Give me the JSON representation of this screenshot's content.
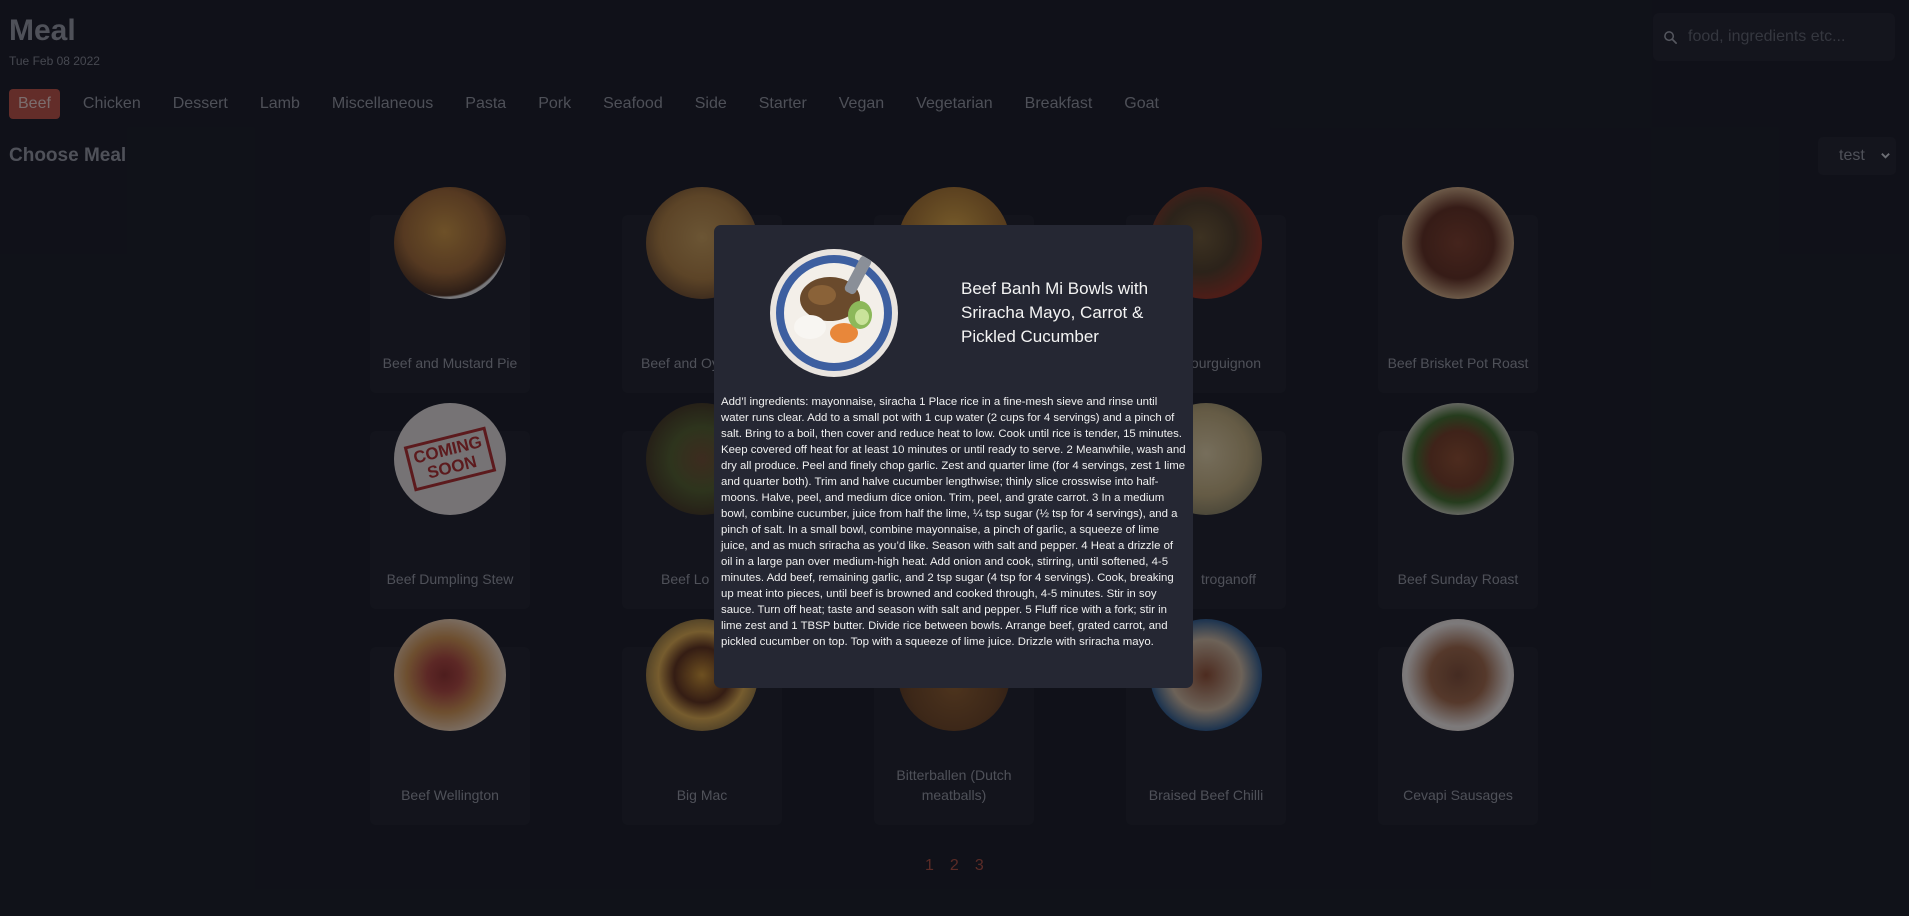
{
  "header": {
    "title": "Meal",
    "date": "Tue Feb 08 2022"
  },
  "search": {
    "placeholder": "food, ingredients etc..."
  },
  "categories": [
    {
      "label": "Beef",
      "active": true
    },
    {
      "label": "Chicken"
    },
    {
      "label": "Dessert"
    },
    {
      "label": "Lamb"
    },
    {
      "label": "Miscellaneous"
    },
    {
      "label": "Pasta"
    },
    {
      "label": "Pork"
    },
    {
      "label": "Seafood"
    },
    {
      "label": "Side"
    },
    {
      "label": "Starter"
    },
    {
      "label": "Vegan"
    },
    {
      "label": "Vegetarian"
    },
    {
      "label": "Breakfast"
    },
    {
      "label": "Goat"
    }
  ],
  "section": {
    "title": "Choose Meal"
  },
  "select": {
    "value": "test"
  },
  "meals": [
    {
      "name": "Beef and Mustard Pie"
    },
    {
      "name": "Beef and Oy"
    },
    {
      "name": ""
    },
    {
      "name": "bourguignon"
    },
    {
      "name": "Beef Brisket Pot Roast"
    },
    {
      "name": "Beef Dumpling Stew"
    },
    {
      "name": "Beef Lo M"
    },
    {
      "name": ""
    },
    {
      "name": "troganoff"
    },
    {
      "name": "Beef Sunday Roast"
    },
    {
      "name": "Beef Wellington"
    },
    {
      "name": "Big Mac"
    },
    {
      "name": "Bitterballen (Dutch meatballs)"
    },
    {
      "name": "Braised Beef Chilli"
    },
    {
      "name": "Cevapi Sausages"
    }
  ],
  "pagination": [
    "1",
    "2",
    "3"
  ],
  "modal": {
    "title": "Beef Banh Mi Bowls with Sriracha Mayo, Carrot & Pickled Cucumber",
    "instructions": "Add’l ingredients: mayonnaise, siracha 1 Place rice in a fine-mesh sieve and rinse until water runs clear. Add to a small pot with 1 cup water (2 cups for 4 servings) and a pinch of salt. Bring to a boil, then cover and reduce heat to low. Cook until rice is tender, 15 minutes. Keep covered off heat for at least 10 minutes or until ready to serve. 2 Meanwhile, wash and dry all produce. Peel and finely chop garlic. Zest and quarter lime (for 4 servings, zest 1 lime and quarter both). Trim and halve cucumber lengthwise; thinly slice crosswise into half-moons. Halve, peel, and medium dice onion. Trim, peel, and grate carrot. 3 In a medium bowl, combine cucumber, juice from half the lime, ¼ tsp sugar (½ tsp for 4 servings), and a pinch of salt. In a small bowl, combine mayonnaise, a pinch of garlic, a squeeze of lime juice, and as much sriracha as you’d like. Season with salt and pepper. 4 Heat a drizzle of oil in a large pan over medium-high heat. Add onion and cook, stirring, until softened, 4-5 minutes. Add beef, remaining garlic, and 2 tsp sugar (4 tsp for 4 servings). Cook, breaking up meat into pieces, until beef is browned and cooked through, 4-5 minutes. Stir in soy sauce. Turn off heat; taste and season with salt and pepper. 5 Fluff rice with a fork; stir in lime zest and 1 TBSP butter. Divide rice between bowls. Arrange beef, grated carrot, and pickled cucumber on top. Top with a squeeze of lime juice. Drizzle with sriracha mayo."
  },
  "colors": {
    "accent": "#b54e40",
    "background": "#161821",
    "card": "#1c1e28",
    "modal": "#252733"
  }
}
